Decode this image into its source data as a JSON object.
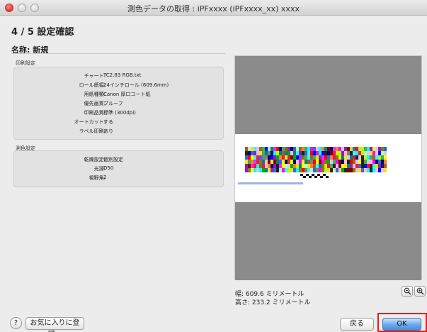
{
  "window": {
    "title": "測色データの取得 : iPFxxxx (iPFxxxx_xx) xxxx"
  },
  "step": {
    "title": "4 / 5  設定確認"
  },
  "name": {
    "label": "名称: 新規"
  },
  "print_settings": {
    "title": "印刷設定",
    "rows": [
      {
        "key": "チャート:",
        "value": "TC2.83 RGB.txt"
      },
      {
        "key": "ロール紙幅:",
        "value": "24インチロール (609.6mm)"
      },
      {
        "key": "用紙種類:",
        "value": "Canon 厚口コート紙"
      },
      {
        "key": "優先画質:",
        "value": "ブルーフ"
      },
      {
        "key": "印刷品質:",
        "value": "標準 (300dpi)"
      },
      {
        "key": "オートカット:",
        "value": "する"
      },
      {
        "key": "ラベル印刷:",
        "value": "あり"
      }
    ]
  },
  "measure_settings": {
    "title": "測色設定",
    "rows": [
      {
        "key": "乾燥設定:",
        "value": "個別設定"
      },
      {
        "key": "光源:",
        "value": "D50"
      },
      {
        "key": "視野角:",
        "value": "2"
      }
    ]
  },
  "preview": {
    "width_text": "幅:  609.6 ミリメートル",
    "height_text": "高さ:  233.2 ミリメートル",
    "gray_color": "#8b8b8b"
  },
  "icons": {
    "zoom_out": "zoom-out-icon",
    "zoom_in": "zoom-in-icon",
    "help": "help-icon"
  },
  "help": {
    "label": "?"
  },
  "buttons": {
    "favorite": "お気に入りに登録...",
    "back": "戻る",
    "ok": "OK"
  },
  "colors": {
    "accent": "#4a8fe0",
    "highlight": "#e02020"
  }
}
